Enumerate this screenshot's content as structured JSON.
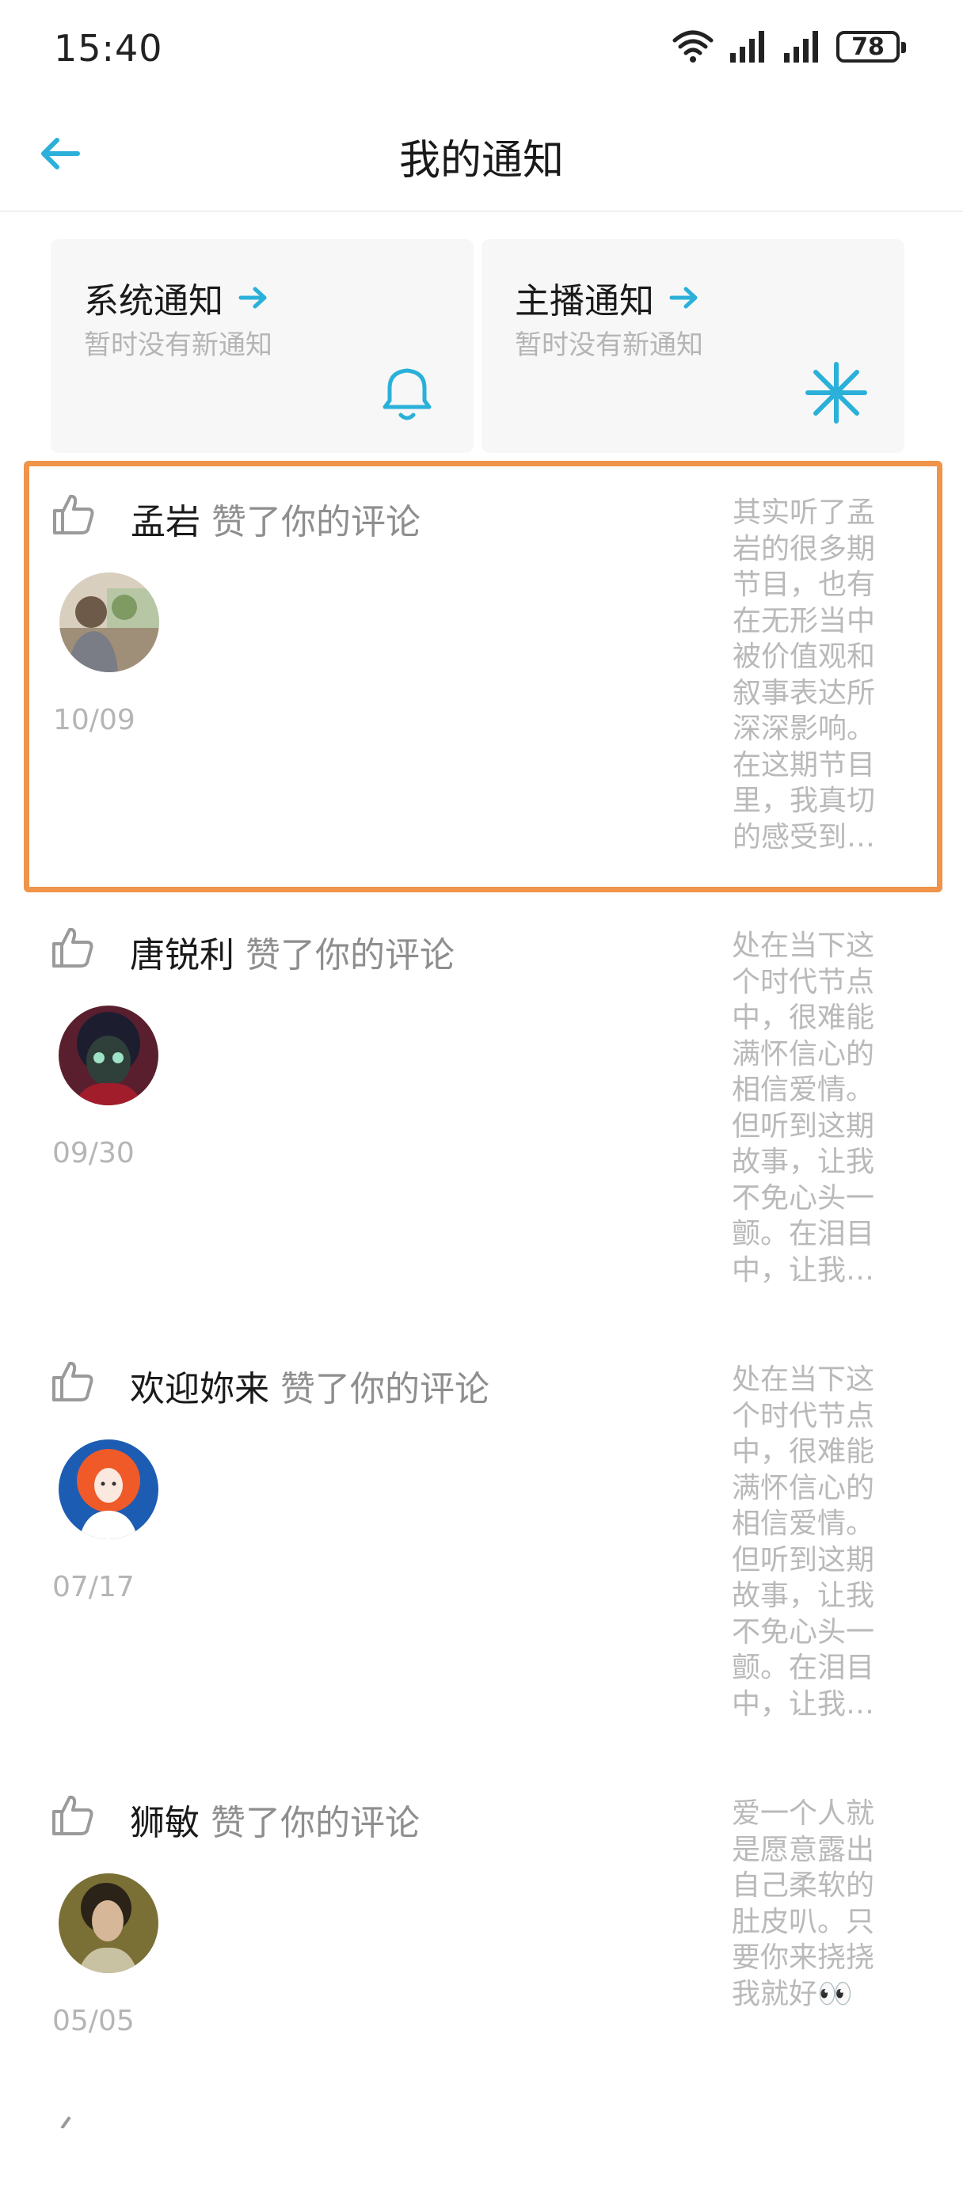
{
  "status_bar": {
    "time": "15:40",
    "battery": "78"
  },
  "header": {
    "title": "我的通知"
  },
  "cards": [
    {
      "title": "系统通知",
      "subtitle": "暂时没有新通知",
      "icon": "bell-icon"
    },
    {
      "title": "主播通知",
      "subtitle": "暂时没有新通知",
      "icon": "asterisk-icon"
    }
  ],
  "notifications": [
    {
      "name": "孟岩",
      "action": "赞了你的评论",
      "date": "10/09",
      "preview": "其实听了孟岩的很多期节目，也有在无形当中被价值观和叙事表达所深深影响。在这期节目里，我真切的感受到…"
    },
    {
      "name": "唐锐利",
      "action": "赞了你的评论",
      "date": "09/30",
      "preview": "处在当下这个时代节点中，很难能满怀信心的相信爱情。但听到这期故事，让我不免心头一颤。在泪目中，让我…"
    },
    {
      "name": "欢迎妳来",
      "action": "赞了你的评论",
      "date": "07/17",
      "preview": "处在当下这个时代节点中，很难能满怀信心的相信爱情。但听到这期故事，让我不免心头一颤。在泪目中，让我…"
    },
    {
      "name": "狮敏",
      "action": "赞了你的评论",
      "date": "05/05",
      "preview": "爱一个人就是愿意露出自己柔软的肚皮叭。只要你来挠挠我就好👀"
    }
  ],
  "colors": {
    "accent": "#2ab0d9",
    "highlight_border": "#ef944a"
  }
}
